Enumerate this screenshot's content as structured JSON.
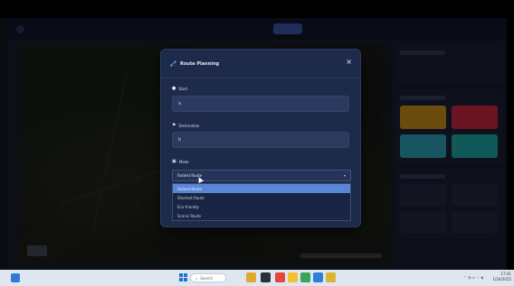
{
  "modal": {
    "title": "Route Planning",
    "close": "×",
    "start": {
      "label": "Start",
      "value": "a"
    },
    "destination": {
      "label": "Destination",
      "value": "b"
    },
    "mode": {
      "label": "Mode",
      "selected": "Fastest Route",
      "options": [
        "Fastest Route",
        "Shortest Route",
        "Eco-friendly",
        "Scenic Route"
      ],
      "highlighted_index": 0
    }
  },
  "taskbar": {
    "search_placeholder": "Search",
    "clock_time": "17:41",
    "clock_date": "1/24/2025"
  },
  "colors": {
    "accent": "#3b50a8",
    "modal_bg": "#1e2a4a",
    "option_highlight": "#5a86d6",
    "tile_colors": [
      "#c28a1a",
      "#c2243f",
      "#2a9bb0",
      "#20a3a3"
    ]
  }
}
